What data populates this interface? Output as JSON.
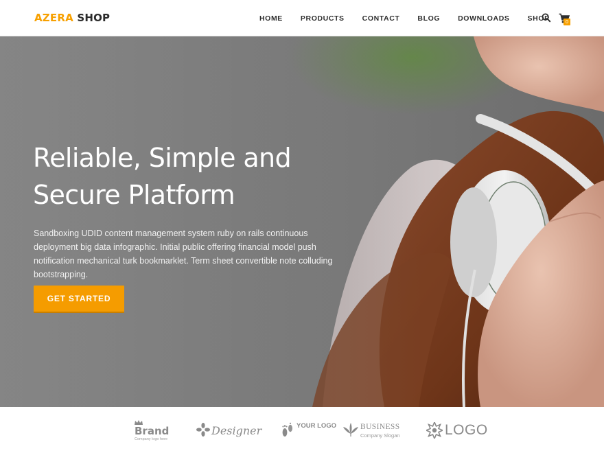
{
  "header": {
    "logo_part1": "AZERA",
    "logo_part2": "SHOP",
    "nav": [
      "HOME",
      "PRODUCTS",
      "CONTACT",
      "BLOG",
      "DOWNLOADS",
      "SHOP"
    ],
    "search_icon": "search-icon",
    "cart_icon": "cart-icon",
    "cart_count": "0"
  },
  "hero": {
    "title_line1": "Reliable, Simple and",
    "title_line2": "Secure Platform",
    "text": "Sandboxing UDID content management system ruby on rails continuous deployment big data infographic. Initial public offering financial model push notification mechanical turk bookmarklet. Term sheet convertible note colluding bootstrapping.",
    "cta_label": "GET STARTED",
    "image_subject": "woman-with-headphones"
  },
  "brands": [
    {
      "name": "Brand",
      "tagline": "Company logo here"
    },
    {
      "name": "Designer"
    },
    {
      "name": "YOUR LOGO"
    },
    {
      "name": "BUSINESS",
      "tagline": "Company Slogan"
    },
    {
      "name": "LOGO"
    }
  ],
  "colors": {
    "accent": "#f59c00",
    "nav_text": "#2e2e2e",
    "brand_gray": "#8a8a8a"
  }
}
